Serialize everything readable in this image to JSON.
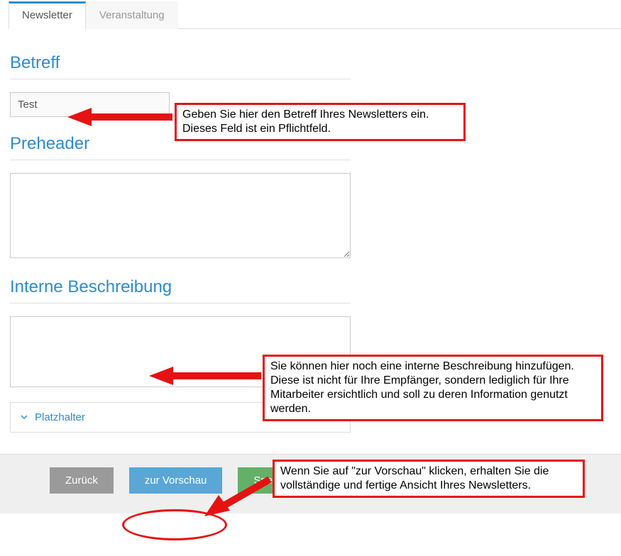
{
  "tabs": {
    "newsletter": "Newsletter",
    "event": "Veranstaltung"
  },
  "sections": {
    "subject_title": "Betreff",
    "subject_value": "Test",
    "preheader_title": "Preheader",
    "preheader_value": "",
    "description_title": "Interne Beschreibung",
    "description_value": ""
  },
  "accordion": {
    "placeholder_label": "Platzhalter"
  },
  "buttons": {
    "back": "Zurück",
    "preview": "zur Vorschau",
    "save": "Speichern"
  },
  "annotations": {
    "subject_hint": "Geben Sie hier den Betreff Ihres Newsletters ein. Dieses Feld ist ein Pflichtfeld.",
    "description_hint": "Sie können hier noch eine interne Beschreibung hinzufügen. Diese ist nicht für Ihre Empfänger, sondern lediglich für Ihre Mitarbeiter ersichtlich und soll zu deren Information genutzt werden.",
    "preview_hint": "Wenn Sie auf \"zur Vorschau\" klicken, erhalten Sie die vollständige und fertige Ansicht Ihres Newsletters."
  }
}
